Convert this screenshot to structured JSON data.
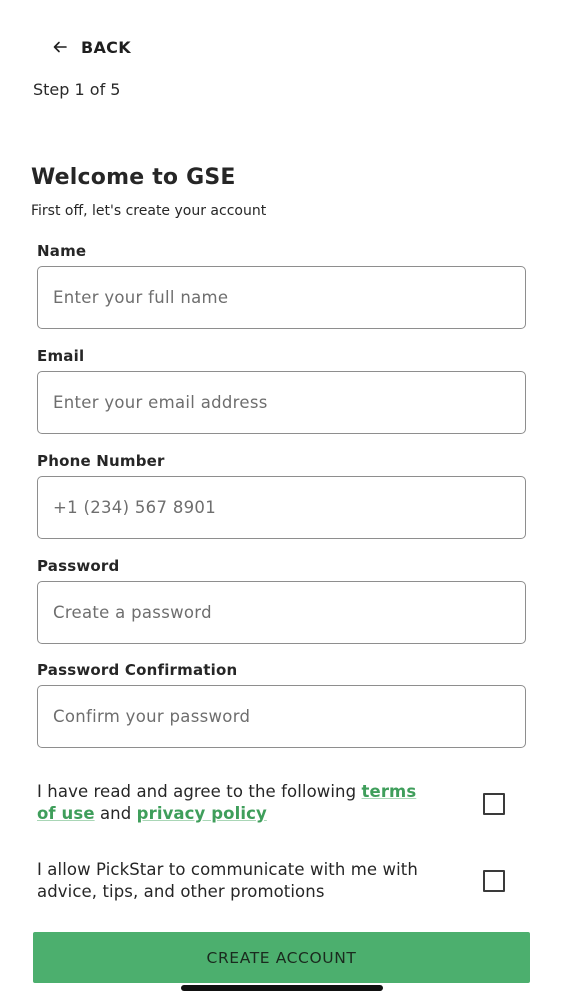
{
  "nav": {
    "back_label": "BACK",
    "step_text": "Step 1 of 5"
  },
  "header": {
    "title": "Welcome to GSE",
    "subtitle": "First off, let's create your account"
  },
  "form": {
    "name": {
      "label": "Name",
      "placeholder": "Enter your full name",
      "value": ""
    },
    "email": {
      "label": "Email",
      "placeholder": "Enter your email address",
      "value": ""
    },
    "phone": {
      "label": "Phone Number",
      "placeholder": "+1 (234) 567 8901",
      "value": ""
    },
    "password": {
      "label": "Password",
      "placeholder": "Create a password",
      "value": ""
    },
    "password_confirmation": {
      "label": "Password Confirmation",
      "placeholder": "Confirm your password",
      "value": ""
    }
  },
  "consents": {
    "terms": {
      "text_before": "I have read and agree to the following ",
      "terms_link": "terms of use",
      "and_text": " and ",
      "privacy_link": "privacy policy",
      "checked": false
    },
    "marketing": {
      "text": "I allow PickStar to communicate with me with advice, tips, and other promotions",
      "checked": false
    }
  },
  "actions": {
    "create_account_label": "CREATE ACCOUNT"
  },
  "colors": {
    "accent_green": "#4caf6e",
    "link_green": "#3f9e5b",
    "border_gray": "#8e8e8e"
  }
}
